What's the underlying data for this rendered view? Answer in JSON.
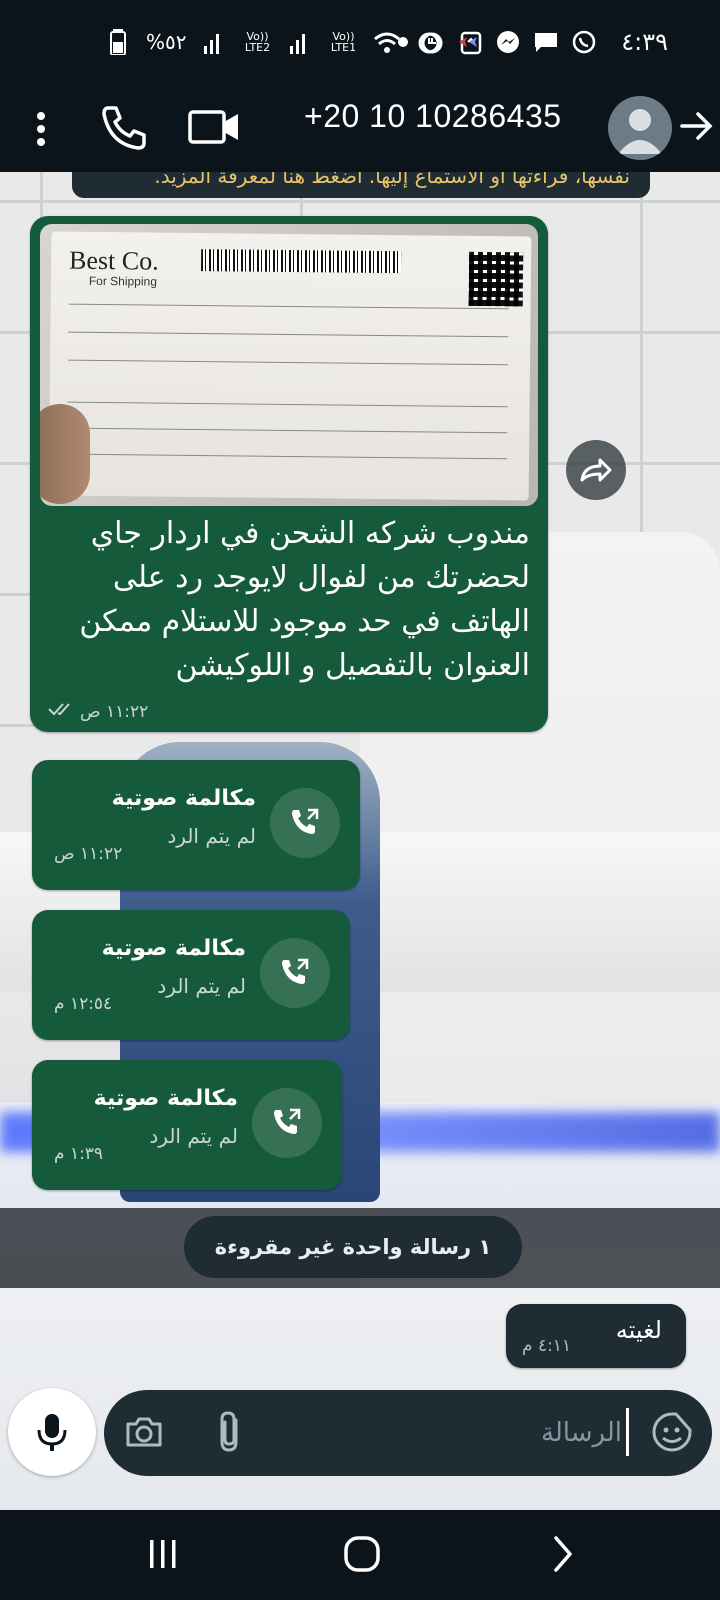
{
  "status_bar": {
    "time": "٤:٣٩",
    "battery": "%٥٢",
    "sim1_label": "Vo)) LTE2",
    "sim2_label": "Vo)) LTE1"
  },
  "header": {
    "contact_phone": "+20 10 10286435"
  },
  "chat": {
    "top_notice": "نفسها، قراءتها أو الاستماع إليها. اضغط هنا لمعرفة المزيد.",
    "image_message": {
      "doc_logo": "Best Co.",
      "doc_sub": "For Shipping",
      "text": "مندوب شركه الشحن في اردار جاي لحضرتك من لفوال لايوجد رد على الهاتف في حد موجود للاستلام ممكن العنوان بالتفصيل و اللوكيشن",
      "time": "١١:٢٢ ص"
    },
    "calls": [
      {
        "title": "مكالمة صوتية",
        "status": "لم يتم الرد",
        "time": "١١:٢٢ ص"
      },
      {
        "title": "مكالمة صوتية",
        "status": "لم يتم الرد",
        "time": "١٢:٥٤ م"
      },
      {
        "title": "مكالمة صوتية",
        "status": "لم يتم الرد",
        "time": "١:٣٩ م"
      }
    ],
    "unread_label": "١ رسالة واحدة غير مقروءة",
    "outgoing": {
      "text": "لغيته",
      "time": "٤:١١ م"
    }
  },
  "composer": {
    "placeholder": "الرسالة"
  },
  "colors": {
    "incoming_bubble": "#155a3b",
    "dark_bg": "#0b141a",
    "panel": "#1f2c33"
  }
}
